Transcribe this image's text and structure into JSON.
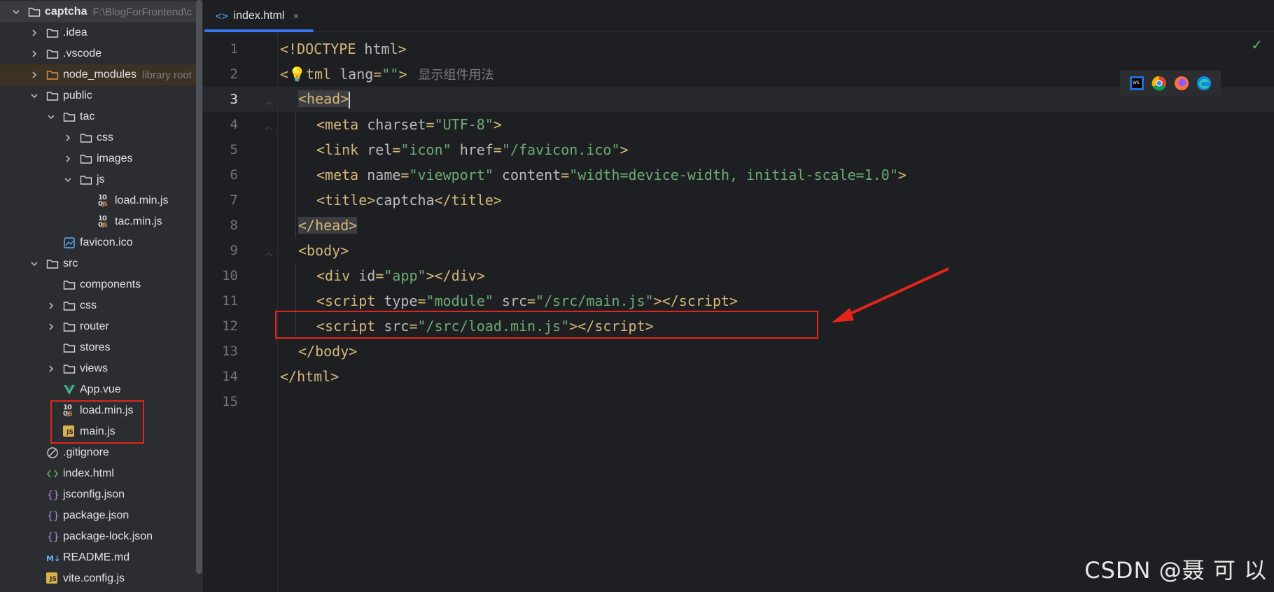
{
  "project": {
    "root_name": "captcha",
    "root_path": "F:\\BlogForFrontend\\c",
    "items": [
      {
        "label": ".idea",
        "hint": ""
      },
      {
        "label": ".vscode",
        "hint": ""
      },
      {
        "label": "node_modules",
        "hint": "library root"
      },
      {
        "label": "public",
        "hint": ""
      },
      {
        "label": "tac",
        "hint": ""
      },
      {
        "label": "css",
        "hint": ""
      },
      {
        "label": "images",
        "hint": ""
      },
      {
        "label": "js",
        "hint": ""
      },
      {
        "label": "load.min.js",
        "hint": ""
      },
      {
        "label": "tac.min.js",
        "hint": ""
      },
      {
        "label": "favicon.ico",
        "hint": ""
      },
      {
        "label": "src",
        "hint": ""
      },
      {
        "label": "components",
        "hint": ""
      },
      {
        "label": "css",
        "hint": ""
      },
      {
        "label": "router",
        "hint": ""
      },
      {
        "label": "stores",
        "hint": ""
      },
      {
        "label": "views",
        "hint": ""
      },
      {
        "label": "App.vue",
        "hint": ""
      },
      {
        "label": "load.min.js",
        "hint": ""
      },
      {
        "label": "main.js",
        "hint": ""
      },
      {
        "label": ".gitignore",
        "hint": ""
      },
      {
        "label": "index.html",
        "hint": ""
      },
      {
        "label": "jsconfig.json",
        "hint": ""
      },
      {
        "label": "package.json",
        "hint": ""
      },
      {
        "label": "package-lock.json",
        "hint": ""
      },
      {
        "label": "README.md",
        "hint": ""
      },
      {
        "label": "vite.config.js",
        "hint": ""
      }
    ]
  },
  "editor": {
    "tab_label": "index.html",
    "tab_icon": "<>",
    "close_glyph": "×",
    "inlay_hint": "显示组件用法",
    "line_numbers": [
      "1",
      "2",
      "3",
      "4",
      "5",
      "6",
      "7",
      "8",
      "9",
      "10",
      "11",
      "12",
      "13",
      "14",
      "15"
    ],
    "current_line": "3"
  },
  "colors": {
    "tag": "#d5b778",
    "attribute": "#bababa",
    "string": "#6aab73",
    "highlight_box": "#e1251b"
  },
  "watermark": "CSDN @聂 可 以"
}
